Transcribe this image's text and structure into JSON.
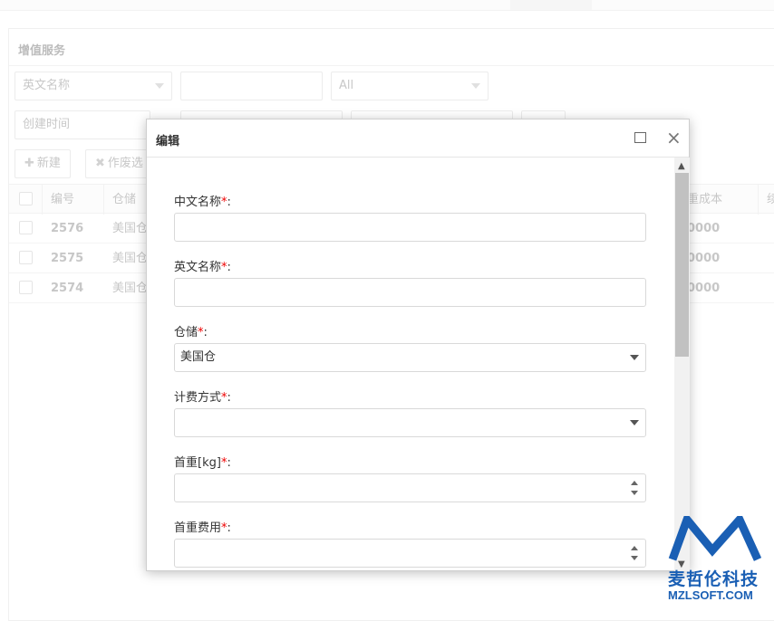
{
  "panel": {
    "title": "增值服务"
  },
  "filters": {
    "field_select": "英文名称",
    "text_value": "",
    "status_select": "All",
    "date_field": "创建时间"
  },
  "toolbar": {
    "new_label": "新建",
    "void_label": "作废选"
  },
  "grid": {
    "headers": {
      "id": "编号",
      "warehouse": "仓储",
      "cost": "重成本",
      "extra": "续"
    },
    "rows": [
      {
        "id": "2576",
        "warehouse": "美国仓",
        "cost": "0000"
      },
      {
        "id": "2575",
        "warehouse": "美国仓",
        "cost": "0000"
      },
      {
        "id": "2574",
        "warehouse": "美国仓",
        "cost": "0000"
      }
    ]
  },
  "dialog": {
    "title": "编辑",
    "fields": {
      "cn_name": {
        "label": "中文名称",
        "value": ""
      },
      "en_name": {
        "label": "英文名称",
        "value": ""
      },
      "warehouse": {
        "label": "仓储",
        "value": "美国仓"
      },
      "billing": {
        "label": "计费方式",
        "value": ""
      },
      "first_weight": {
        "label": "首重[kg]",
        "value": ""
      },
      "first_fee": {
        "label": "首重费用",
        "value": ""
      }
    },
    "required_mark": "*",
    "colon": ":"
  },
  "watermark": {
    "cn": "麦哲伦科技",
    "en": "MZLSOFT.COM",
    "color": "#1a5fb4"
  }
}
